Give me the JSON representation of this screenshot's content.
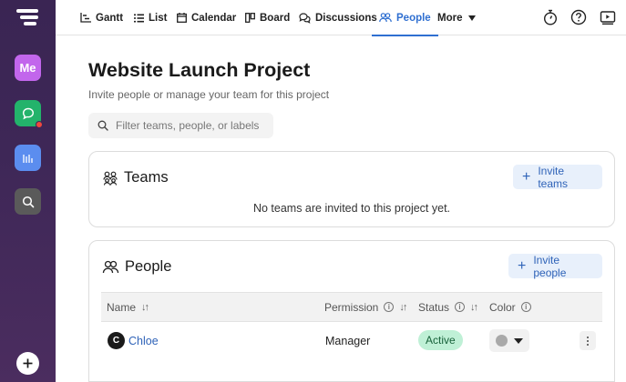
{
  "nav": {
    "tabs": [
      {
        "label": "Gantt",
        "icon": "gantt-icon"
      },
      {
        "label": "List",
        "icon": "list-icon"
      },
      {
        "label": "Calendar",
        "icon": "calendar-icon"
      },
      {
        "label": "Board",
        "icon": "board-icon"
      },
      {
        "label": "Discussions",
        "icon": "discussions-icon"
      },
      {
        "label": "People",
        "icon": "people-icon",
        "active": true
      },
      {
        "label": "More",
        "icon": "chevron-down-icon"
      }
    ],
    "right_icons": [
      "stopwatch-icon",
      "help-icon",
      "video-icon"
    ]
  },
  "sidebar": {
    "me_label": "Me",
    "items": [
      "logo-icon",
      "me-avatar",
      "chat-icon",
      "reports-icon",
      "search-icon",
      "add-icon"
    ]
  },
  "header": {
    "title": "Website Launch Project",
    "subtitle": "Invite people or manage your team for this project"
  },
  "search": {
    "placeholder": "Filter teams, people, or labels"
  },
  "teams": {
    "title": "Teams",
    "invite_label": "Invite teams",
    "empty_message": "No teams are invited to this project yet."
  },
  "people": {
    "title": "People",
    "invite_label": "Invite people",
    "columns": {
      "name": "Name",
      "permission": "Permission",
      "status": "Status",
      "color": "Color"
    },
    "rows": [
      {
        "initial": "C",
        "name": "Chloe",
        "permission": "Manager",
        "status": "Active"
      }
    ]
  },
  "colors": {
    "accent": "#2f6fd1",
    "sidebar": "#3e2757",
    "status_active_bg": "#bff0d6"
  }
}
